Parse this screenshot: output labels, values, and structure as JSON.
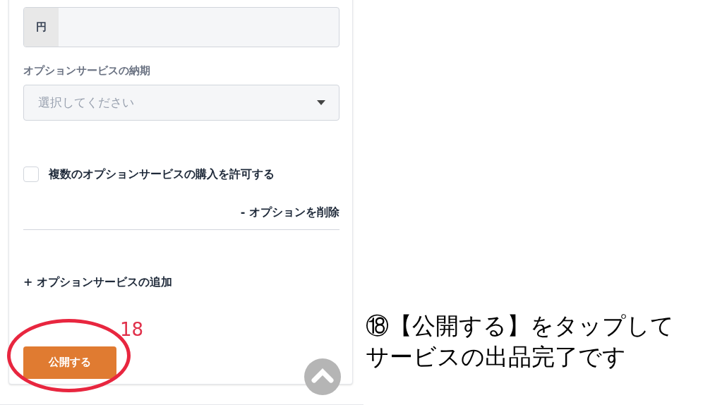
{
  "price_field": {
    "unit": "円"
  },
  "delivery": {
    "label": "オプションサービスの納期",
    "placeholder": "選択してください"
  },
  "allow_multiple": {
    "label": "複数のオプションサービスの購入を許可する",
    "checked": false
  },
  "delete_option": "- オプションを削除",
  "add_option": "+ オプションサービスの追加",
  "publish_button": "公開する",
  "annotation": {
    "number": "18",
    "caption_lines": [
      "⑱【公開する】をタップして",
      "サービスの出品完了です"
    ]
  }
}
